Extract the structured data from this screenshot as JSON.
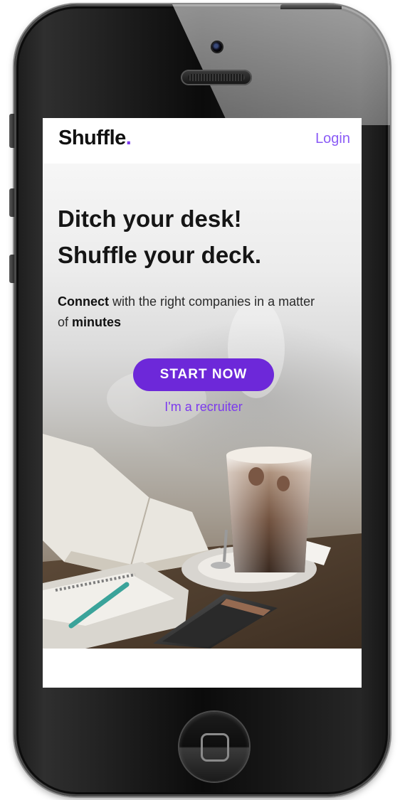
{
  "app": {
    "brand": "Shuffle",
    "brand_dot": ".",
    "login_label": "Login"
  },
  "hero": {
    "title_line1": "Ditch your desk!",
    "title_line2": "Shuffle your deck.",
    "tagline_bold1": "Connect",
    "tagline_mid": " with the right companies in a matter of ",
    "tagline_bold2": "minutes",
    "cta_label": "START NOW",
    "recruiter_label": "I'm a recruiter"
  },
  "colors": {
    "accent": "#6d28d9",
    "link": "#8b5cf6",
    "text": "#151515"
  },
  "icons": {
    "home": "home-button-icon",
    "camera": "front-camera-icon",
    "speaker": "earpiece-speaker-icon"
  }
}
